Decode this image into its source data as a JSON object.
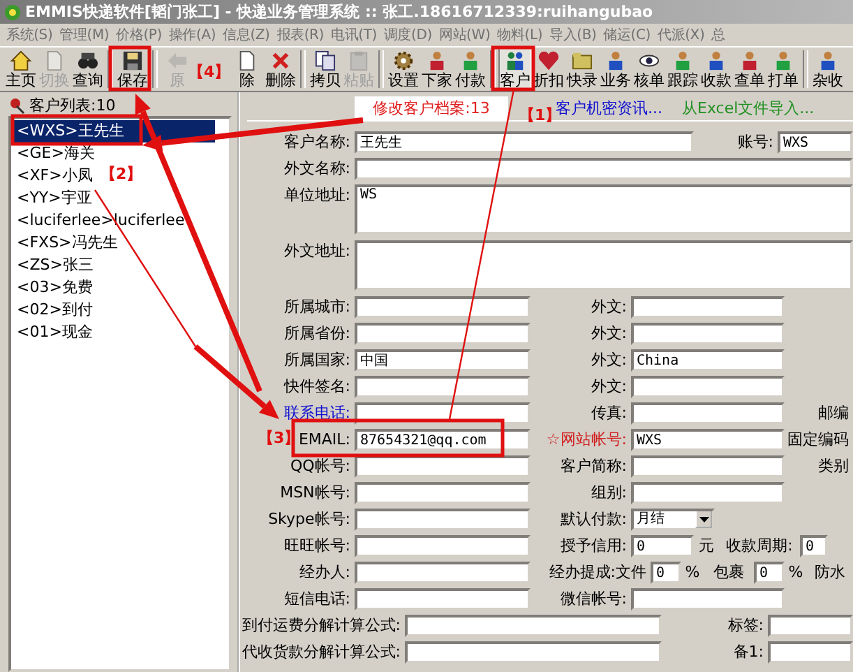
{
  "window": {
    "title": "EMMIS快递软件[韬门张工] - 快递业务管理系统 :: 张工.18616712339:ruihangubao"
  },
  "menu": [
    "系统(S)",
    "管理(M)",
    "价格(P)",
    "操作(A)",
    "信息(Z)",
    "报表(R)",
    "电讯(T)",
    "调度(D)",
    "网站(W)",
    "物料(L)",
    "导入(B)",
    "储运(C)",
    "代派(X)",
    "总"
  ],
  "toolbar": [
    {
      "label": "主页",
      "disabled": false,
      "selected": false,
      "separator": false
    },
    {
      "label": "切换",
      "disabled": true,
      "selected": false,
      "separator": false
    },
    {
      "label": "查询",
      "disabled": false,
      "selected": false,
      "separator": false
    },
    {
      "label": "保存",
      "disabled": false,
      "selected": false,
      "separator": true
    },
    {
      "label": "原",
      "disabled": true,
      "selected": false,
      "separator": true
    },
    {
      "label": "除",
      "disabled": false,
      "selected": false,
      "separator": false
    },
    {
      "label": "删除",
      "disabled": false,
      "selected": false,
      "separator": false
    },
    {
      "label": "拷贝",
      "disabled": false,
      "selected": false,
      "separator": true
    },
    {
      "label": "粘贴",
      "disabled": true,
      "selected": false,
      "separator": false
    },
    {
      "label": "设置",
      "disabled": false,
      "selected": false,
      "separator": true
    },
    {
      "label": "下家",
      "disabled": false,
      "selected": false,
      "separator": false
    },
    {
      "label": "付款",
      "disabled": false,
      "selected": false,
      "separator": false
    },
    {
      "label": "客户",
      "disabled": false,
      "selected": true,
      "separator": true
    },
    {
      "label": "折扣",
      "disabled": false,
      "selected": false,
      "separator": false
    },
    {
      "label": "快录",
      "disabled": false,
      "selected": false,
      "separator": false
    },
    {
      "label": "业务",
      "disabled": false,
      "selected": false,
      "separator": false
    },
    {
      "label": "核单",
      "disabled": false,
      "selected": false,
      "separator": false
    },
    {
      "label": "跟踪",
      "disabled": false,
      "selected": false,
      "separator": false
    },
    {
      "label": "收款",
      "disabled": false,
      "selected": false,
      "separator": false
    },
    {
      "label": "查单",
      "disabled": false,
      "selected": false,
      "separator": false
    },
    {
      "label": "打单",
      "disabled": false,
      "selected": false,
      "separator": false
    },
    {
      "label": "杂收",
      "disabled": false,
      "selected": false,
      "separator": true
    }
  ],
  "customer_list": {
    "title": "客户列表:10",
    "items": [
      {
        "label": "<WXS>王先生",
        "selected": true
      },
      {
        "label": "<GE>海关",
        "selected": false
      },
      {
        "label": "<XF>小凤",
        "selected": false
      },
      {
        "label": "<YY>宇亚",
        "selected": false
      },
      {
        "label": "<luciferlee>luciferlee",
        "selected": false
      },
      {
        "label": "<FXS>冯先生",
        "selected": false
      },
      {
        "label": "<ZS>张三",
        "selected": false
      },
      {
        "label": "<03>免费",
        "selected": false
      },
      {
        "label": "<02>到付",
        "selected": false
      },
      {
        "label": "<01>现金",
        "selected": false
      }
    ]
  },
  "tabs": [
    {
      "label": "修改客户档案:13",
      "selected": true,
      "color": "#e02020"
    },
    {
      "label": "客户机密资讯...",
      "selected": false,
      "color": "#1010d0"
    },
    {
      "label": "从Excel文件导入...",
      "selected": false,
      "color": "#209020"
    }
  ],
  "form": [
    {
      "kind": "account",
      "cells": [
        {
          "kind": "label",
          "text": "客户名称:"
        },
        {
          "kind": "input",
          "value": "王先生"
        },
        {
          "kind": "label",
          "text": "账号:"
        },
        {
          "kind": "input",
          "value": "WXS"
        }
      ]
    },
    {
      "kind": "wide",
      "cells": [
        {
          "kind": "label",
          "text": "外文名称:"
        },
        {
          "kind": "input"
        }
      ]
    },
    {
      "kind": "area",
      "cells": [
        {
          "kind": "label",
          "text": "单位地址:"
        },
        {
          "kind": "area",
          "value": "WS"
        }
      ]
    },
    {
      "kind": "area2",
      "cells": [
        {
          "kind": "label",
          "text": "外文地址:"
        },
        {
          "kind": "area"
        }
      ]
    },
    {
      "kind": "pair",
      "cells": [
        {
          "kind": "label",
          "text": "所属城市:"
        },
        {
          "kind": "input"
        },
        {
          "kind": "label",
          "text": "外文:"
        },
        {
          "kind": "input"
        }
      ]
    },
    {
      "kind": "pair",
      "cells": [
        {
          "kind": "label",
          "text": "所属省份:"
        },
        {
          "kind": "input"
        },
        {
          "kind": "label",
          "text": "外文:"
        },
        {
          "kind": "input"
        }
      ]
    },
    {
      "kind": "pair",
      "cells": [
        {
          "kind": "label",
          "text": "所属国家:"
        },
        {
          "kind": "input",
          "value": "中国"
        },
        {
          "kind": "label",
          "text": "外文:"
        },
        {
          "kind": "input",
          "value": "China"
        }
      ]
    },
    {
      "kind": "pair",
      "cells": [
        {
          "kind": "label",
          "text": "快件签名:"
        },
        {
          "kind": "input"
        },
        {
          "kind": "label",
          "text": "外文:"
        },
        {
          "kind": "input"
        }
      ]
    },
    {
      "kind": "pair",
      "cells": [
        {
          "kind": "label",
          "text": "联系电话:",
          "color": "#1010d0"
        },
        {
          "kind": "input"
        },
        {
          "kind": "label",
          "text": "传真:"
        },
        {
          "kind": "input"
        },
        {
          "kind": "label",
          "text": "邮编"
        }
      ]
    },
    {
      "kind": "pair",
      "cells": [
        {
          "kind": "label",
          "text": "EMAIL:"
        },
        {
          "kind": "input",
          "value": "87654321@qq.com"
        },
        {
          "kind": "label",
          "text": "☆网站帐号:",
          "color": "#d02020"
        },
        {
          "kind": "input",
          "value": "WXS"
        },
        {
          "kind": "label",
          "text": "固定编码"
        }
      ]
    },
    {
      "kind": "pair",
      "cells": [
        {
          "kind": "label",
          "text": "QQ帐号:"
        },
        {
          "kind": "input"
        },
        {
          "kind": "label",
          "text": "客户简称:"
        },
        {
          "kind": "input"
        },
        {
          "kind": "label",
          "text": "类别"
        }
      ]
    },
    {
      "kind": "pair",
      "cells": [
        {
          "kind": "label",
          "text": "MSN帐号:"
        },
        {
          "kind": "input"
        },
        {
          "kind": "label",
          "text": "组别:"
        },
        {
          "kind": "input"
        }
      ]
    },
    {
      "kind": "pair",
      "cells": [
        {
          "kind": "label",
          "text": "Skype帐号:"
        },
        {
          "kind": "input"
        },
        {
          "kind": "label",
          "text": "默认付款:"
        },
        {
          "kind": "select",
          "value": "月结"
        }
      ]
    },
    {
      "kind": "credit",
      "cells": [
        {
          "kind": "label",
          "text": "旺旺帐号:"
        },
        {
          "kind": "input"
        },
        {
          "kind": "label",
          "text": "授予信用:"
        },
        {
          "kind": "input",
          "value": "0"
        },
        {
          "kind": "text",
          "text": "元"
        },
        {
          "kind": "text",
          "text": "收款周期:"
        },
        {
          "kind": "input",
          "value": "0"
        }
      ]
    },
    {
      "kind": "commission",
      "cells": [
        {
          "kind": "label",
          "text": "经办人:"
        },
        {
          "kind": "input"
        },
        {
          "kind": "label",
          "text": "经办提成:文件"
        },
        {
          "kind": "input",
          "value": "0"
        },
        {
          "kind": "text",
          "text": "%"
        },
        {
          "kind": "text",
          "text": "包裹"
        },
        {
          "kind": "input",
          "value": "0"
        },
        {
          "kind": "text",
          "text": "%"
        },
        {
          "kind": "text",
          "text": "防水"
        }
      ]
    },
    {
      "kind": "pair",
      "cells": [
        {
          "kind": "label",
          "text": "短信电话:"
        },
        {
          "kind": "input"
        },
        {
          "kind": "label",
          "text": "微信帐号:"
        },
        {
          "kind": "input"
        }
      ]
    },
    {
      "kind": "formula",
      "cells": [
        {
          "kind": "label",
          "text": "到付运费分解计算公式:"
        },
        {
          "kind": "input"
        },
        {
          "kind": "label",
          "text": "标签:"
        },
        {
          "kind": "input"
        }
      ]
    },
    {
      "kind": "formula",
      "cells": [
        {
          "kind": "label",
          "text": "代收货款分解计算公式:"
        },
        {
          "kind": "input"
        },
        {
          "kind": "label",
          "text": "备1:"
        },
        {
          "kind": "input"
        }
      ]
    }
  ],
  "annotations": [
    "【1】",
    "【2】",
    "【3】",
    "【4】"
  ]
}
